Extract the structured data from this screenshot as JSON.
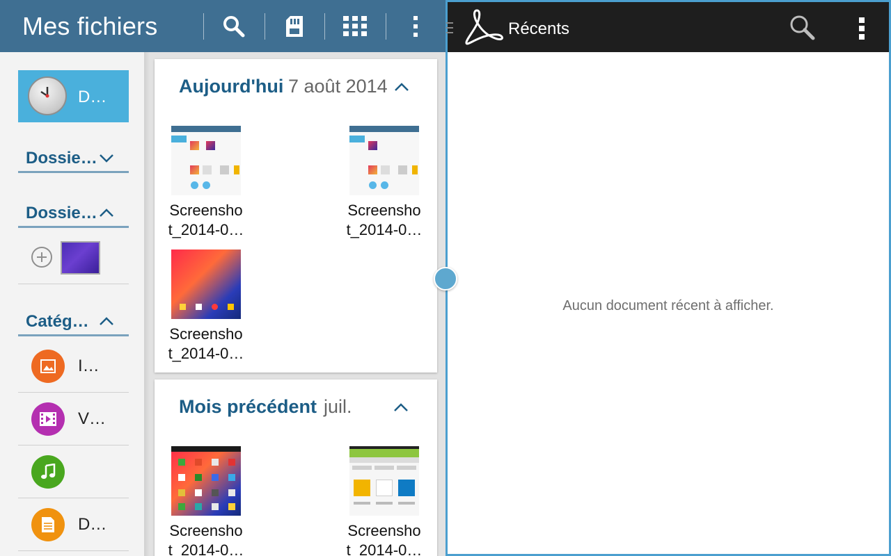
{
  "left_app": {
    "title": "Mes fichiers",
    "toolbar": [
      {
        "name": "search-button",
        "icon": "search-icon"
      },
      {
        "name": "sd-card-button",
        "icon": "sd-card-icon"
      },
      {
        "name": "grid-view-button",
        "icon": "grid-icon"
      },
      {
        "name": "more-options-button",
        "icon": "more-vertical-icon"
      }
    ],
    "sidebar": {
      "recent_label": "D…",
      "sections": [
        {
          "label": "Dossie…",
          "expanded": false
        },
        {
          "label": "Dossie…",
          "expanded": true
        },
        {
          "label": "Catég…",
          "expanded": true
        }
      ],
      "categories": [
        {
          "label": "I…",
          "icon": "image-icon",
          "color": "#ee6a22"
        },
        {
          "label": "V…",
          "icon": "video-icon",
          "color": "#b42fb0"
        },
        {
          "label": "",
          "icon": "music-icon",
          "color": "#49a71f"
        },
        {
          "label": "D…",
          "icon": "document-icon",
          "color": "#f0920f"
        }
      ]
    },
    "groups": [
      {
        "title": "Aujourd'hui",
        "date": "7 août 2014",
        "files": [
          {
            "line1": "Screensho",
            "line2": "t_2014-0…"
          },
          {
            "line1": "Screensho",
            "line2": "t_2014-0…"
          },
          {
            "line1": "Screensho",
            "line2": "t_2014-0…"
          }
        ]
      },
      {
        "title": "Mois précédent",
        "date": "juil.",
        "files": [
          {
            "line1": "Screensho",
            "line2": "t_2014-0…"
          },
          {
            "line1": "Screensho",
            "line2": "t_2014-0…"
          }
        ]
      }
    ]
  },
  "right_app": {
    "title": "Récents",
    "empty_message": "Aucun document récent à afficher."
  },
  "colors": {
    "mf_header": "#3f6f92",
    "accent_blue": "#1c5d86",
    "recent_tile": "#4ab0dc",
    "reader_header": "#1e1e1e",
    "split_border": "#4b9fcf"
  }
}
